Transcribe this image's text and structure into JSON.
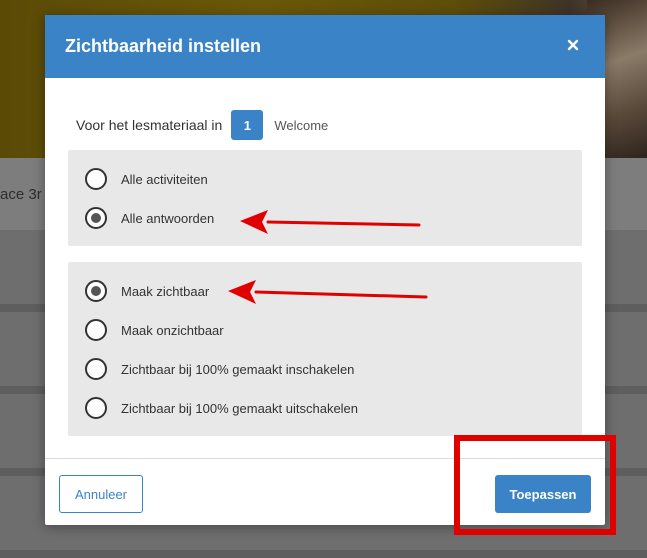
{
  "background": {
    "partial_heading": "ace 3r"
  },
  "modal": {
    "title": "Zichtbaarheid instellen",
    "close_icon": "close-icon",
    "scope": {
      "label": "Voor het lesmateriaal in",
      "chapter_number": "1",
      "chapter_name": "Welcome"
    },
    "target_group": {
      "options": [
        {
          "label": "Alle activiteiten",
          "checked": false
        },
        {
          "label": "Alle antwoorden",
          "checked": true
        }
      ]
    },
    "visibility_group": {
      "options": [
        {
          "label": "Maak zichtbaar",
          "checked": true
        },
        {
          "label": "Maak onzichtbaar",
          "checked": false
        },
        {
          "label": "Zichtbaar bij 100% gemaakt inschakelen",
          "checked": false
        },
        {
          "label": "Zichtbaar bij 100% gemaakt uitschakelen",
          "checked": false
        }
      ]
    },
    "footer": {
      "cancel_label": "Annuleer",
      "apply_label": "Toepassen"
    }
  },
  "colors": {
    "primary": "#3a83c6",
    "annotation": "#e00000",
    "group_background": "#e8e8e8"
  }
}
